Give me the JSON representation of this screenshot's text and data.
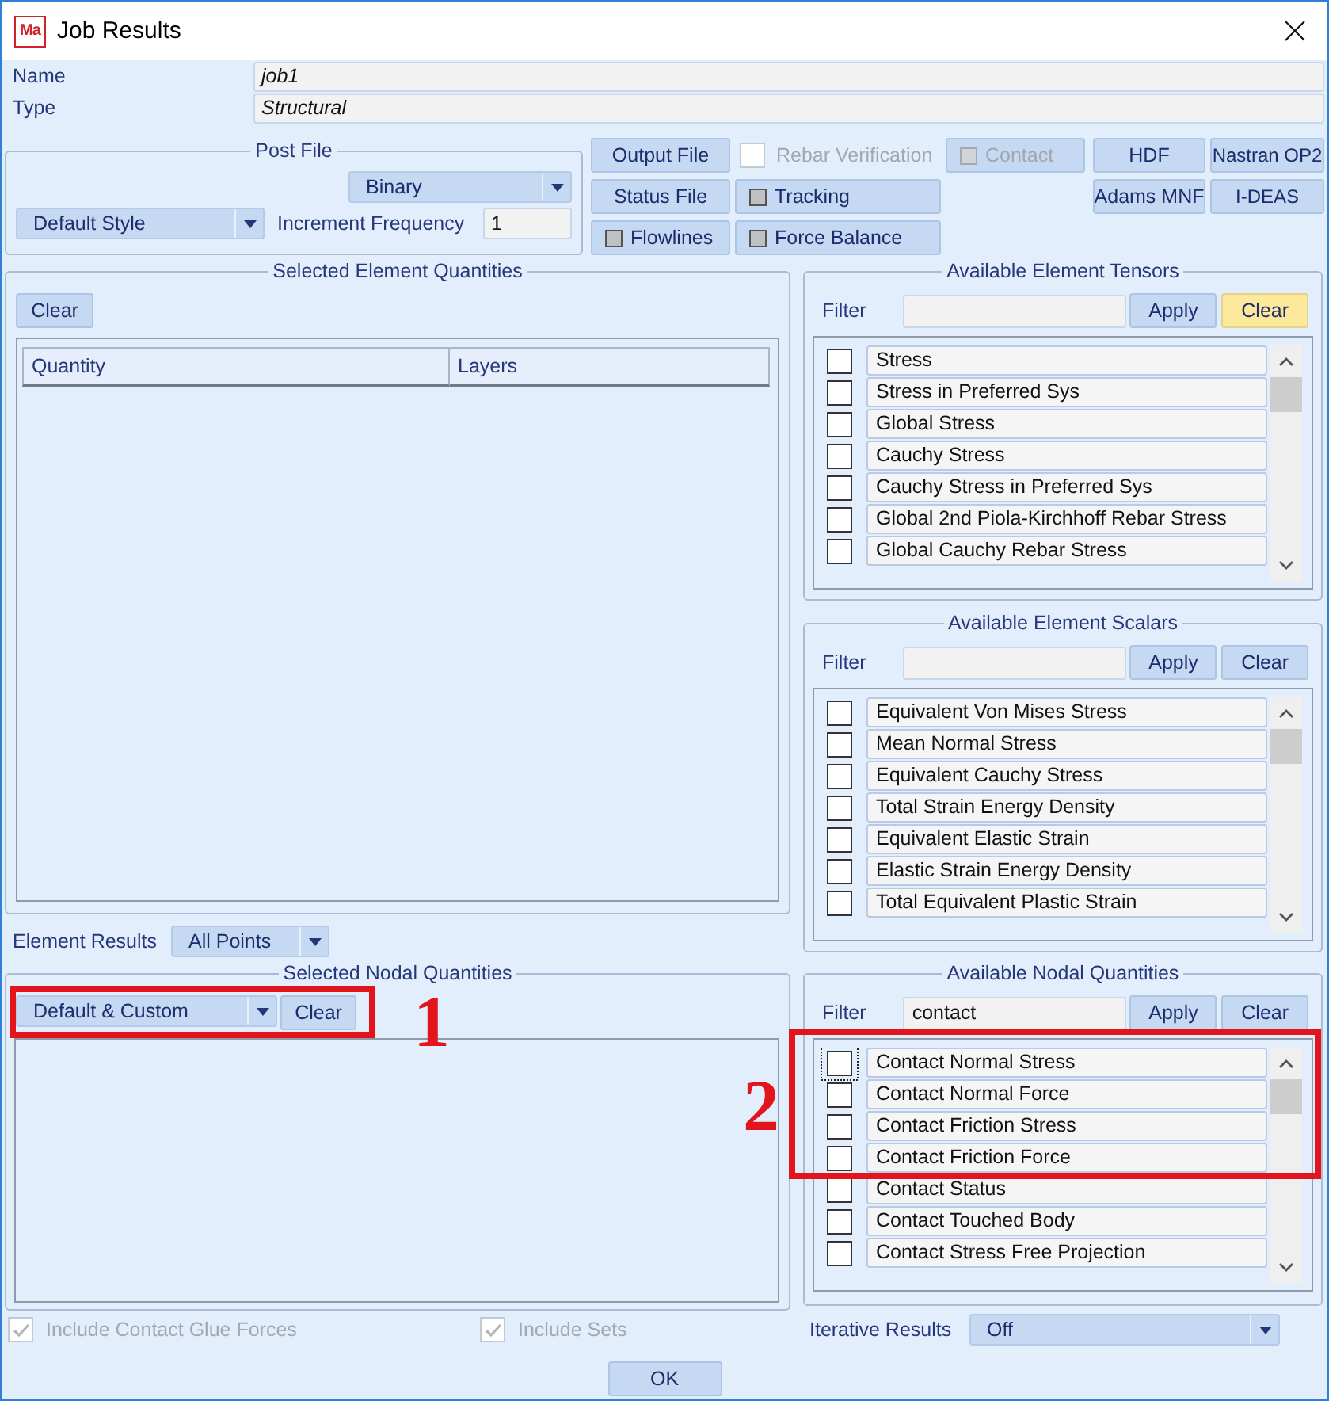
{
  "window": {
    "title": "Job Results",
    "icon_text": "Ma"
  },
  "job_fields": [
    {
      "label": "Name",
      "value": "job1"
    },
    {
      "label": "Type",
      "value": "Structural"
    }
  ],
  "post_file": {
    "title": "Post File",
    "format": "Binary",
    "style": "Default Style",
    "increment_label": "Increment Frequency",
    "increment_value": "1"
  },
  "output_columns": [
    [
      {
        "kind": "button",
        "label": "Output File",
        "disabled": false
      },
      {
        "kind": "button",
        "label": "Status File",
        "disabled": false
      },
      {
        "kind": "toggle",
        "label": "Flowlines",
        "checked": false,
        "disabled": false
      }
    ],
    [
      {
        "kind": "checkbox",
        "label": "Rebar Verification",
        "checked": false,
        "disabled": true
      },
      {
        "kind": "toggle",
        "label": "Tracking",
        "checked": false,
        "disabled": false
      },
      {
        "kind": "toggle",
        "label": "Force Balance",
        "checked": false,
        "disabled": false
      }
    ],
    [
      {
        "kind": "toggle",
        "label": "Contact",
        "checked": false,
        "disabled": true
      }
    ],
    [
      {
        "kind": "button",
        "label": "HDF",
        "disabled": false
      },
      {
        "kind": "button",
        "label": "Adams MNF",
        "disabled": false
      }
    ],
    [
      {
        "kind": "button",
        "label": "Nastran OP2",
        "disabled": false
      },
      {
        "kind": "button",
        "label": "I-DEAS",
        "disabled": false
      }
    ]
  ],
  "selected_element_quantities": {
    "title": "Selected Element Quantities",
    "clear": "Clear",
    "columns": [
      "Quantity",
      "Layers"
    ]
  },
  "element_tensors": {
    "title": "Available Element Tensors",
    "filter_label": "Filter",
    "apply": "Apply",
    "clear": "Clear",
    "clear_highlighted": true,
    "items": [
      {
        "label": "Stress",
        "checked": false
      },
      {
        "label": "Stress in Preferred Sys",
        "checked": false
      },
      {
        "label": "Global Stress",
        "checked": false
      },
      {
        "label": "Cauchy Stress",
        "checked": false
      },
      {
        "label": "Cauchy Stress in Preferred Sys",
        "checked": false
      },
      {
        "label": "Global 2nd Piola-Kirchhoff Rebar Stress",
        "checked": false
      },
      {
        "label": "Global Cauchy Rebar Stress",
        "checked": false
      }
    ]
  },
  "element_scalars": {
    "title": "Available Element Scalars",
    "filter_label": "Filter",
    "apply": "Apply",
    "clear": "Clear",
    "clear_highlighted": false,
    "items": [
      {
        "label": "Equivalent Von Mises Stress",
        "checked": false
      },
      {
        "label": "Mean Normal Stress",
        "checked": false
      },
      {
        "label": "Equivalent Cauchy Stress",
        "checked": false
      },
      {
        "label": "Total Strain Energy Density",
        "checked": false
      },
      {
        "label": "Equivalent Elastic Strain",
        "checked": false
      },
      {
        "label": "Elastic Strain Energy Density",
        "checked": false
      },
      {
        "label": "Total Equivalent Plastic Strain",
        "checked": false
      }
    ]
  },
  "element_results": {
    "label": "Element Results",
    "value": "All Points"
  },
  "selected_nodal_quantities": {
    "title": "Selected Nodal Quantities",
    "preset": "Default & Custom",
    "clear": "Clear"
  },
  "nodal_quantities": {
    "title": "Available Nodal Quantities",
    "filter_label": "Filter",
    "filter_value": "contact",
    "apply": "Apply",
    "clear": "Clear",
    "clear_highlighted": false,
    "items": [
      {
        "label": "Contact Normal Stress",
        "checked": false,
        "focused": true
      },
      {
        "label": "Contact Normal Force",
        "checked": false,
        "focused": false
      },
      {
        "label": "Contact Friction Stress",
        "checked": false,
        "focused": false
      },
      {
        "label": "Contact Friction Force",
        "checked": false,
        "focused": false
      },
      {
        "label": "Contact Status",
        "checked": false,
        "focused": false
      },
      {
        "label": "Contact Touched Body",
        "checked": false,
        "focused": false
      },
      {
        "label": "Contact Stress Free Projection",
        "checked": false,
        "focused": false
      }
    ]
  },
  "options": [
    {
      "label": "Include Contact Glue Forces",
      "checked": true,
      "disabled": true
    },
    {
      "label": "Include Sets",
      "checked": true,
      "disabled": true
    }
  ],
  "iterative_results": {
    "label": "Iterative Results",
    "value": "Off"
  },
  "buttons": [
    "OK"
  ],
  "annotations": [
    {
      "label": "1"
    },
    {
      "label": "2"
    }
  ]
}
